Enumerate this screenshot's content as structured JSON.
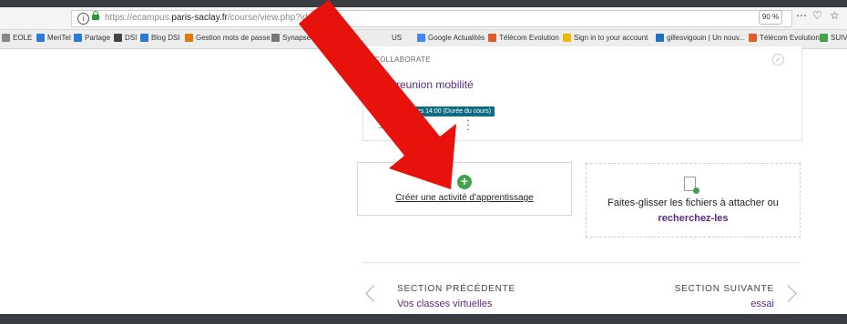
{
  "browser": {
    "url_prefix": "https://ecampus.",
    "url_domain": "paris-saclay.fr",
    "url_path": "/course/view.php?id=16548",
    "zoom": "90 %",
    "icons": [
      "info-icon",
      "lock-icon",
      "more-icon",
      "pocket-icon",
      "bookmark-star-icon"
    ]
  },
  "bookmarks": [
    {
      "label": "EOLE",
      "color": "#888888"
    },
    {
      "label": "MeriTel",
      "color": "#2a7bd5"
    },
    {
      "label": "Partage",
      "color": "#2a7bd5"
    },
    {
      "label": "DSI",
      "color": "#444444"
    },
    {
      "label": "Blog DSI",
      "color": "#2a7bd5"
    },
    {
      "label": "Gestion mots de passe",
      "color": "#e07b00"
    },
    {
      "label": "SynapseS",
      "color": "#777777"
    },
    {
      "label": "M",
      "color": "#1a73c8"
    },
    {
      "label": "US",
      "color": "#1a73c8"
    },
    {
      "label": "Google Actualités",
      "color": "#4285f4"
    },
    {
      "label": "Télécom Evolution",
      "color": "#e05a2a"
    },
    {
      "label": "Sign in to your account",
      "color": "#f2b600"
    },
    {
      "label": "gillesvigouin | Un nouv...",
      "color": "#1a73c8"
    },
    {
      "label": "Télécom Evolution",
      "color": "#e05a2a"
    },
    {
      "label": "SUIVI MOOC IMT afra",
      "color": "#3fa34d"
    }
  ],
  "activity": {
    "type": "COLLABORATE",
    "title": "reunion mobilité",
    "date": "vendredi 6 mars 14:00 (Durée du cours)"
  },
  "create_activity": {
    "label": "Créer une activité d'apprentissage"
  },
  "dropzone": {
    "text": "Faites-glisser les fichiers à attacher ou",
    "link": "recherchez-les"
  },
  "section_nav": {
    "prev_heading": "SECTION PRÉCÉDENTE",
    "prev_link": "Vos classes virtuelles",
    "next_heading": "SECTION SUIVANTE",
    "next_link": "essai"
  },
  "colors": {
    "link_purple": "#5b2a86",
    "annotation_red": "#e8120c",
    "date_badge": "#0d6b82",
    "add_green": "#3fa34d"
  }
}
